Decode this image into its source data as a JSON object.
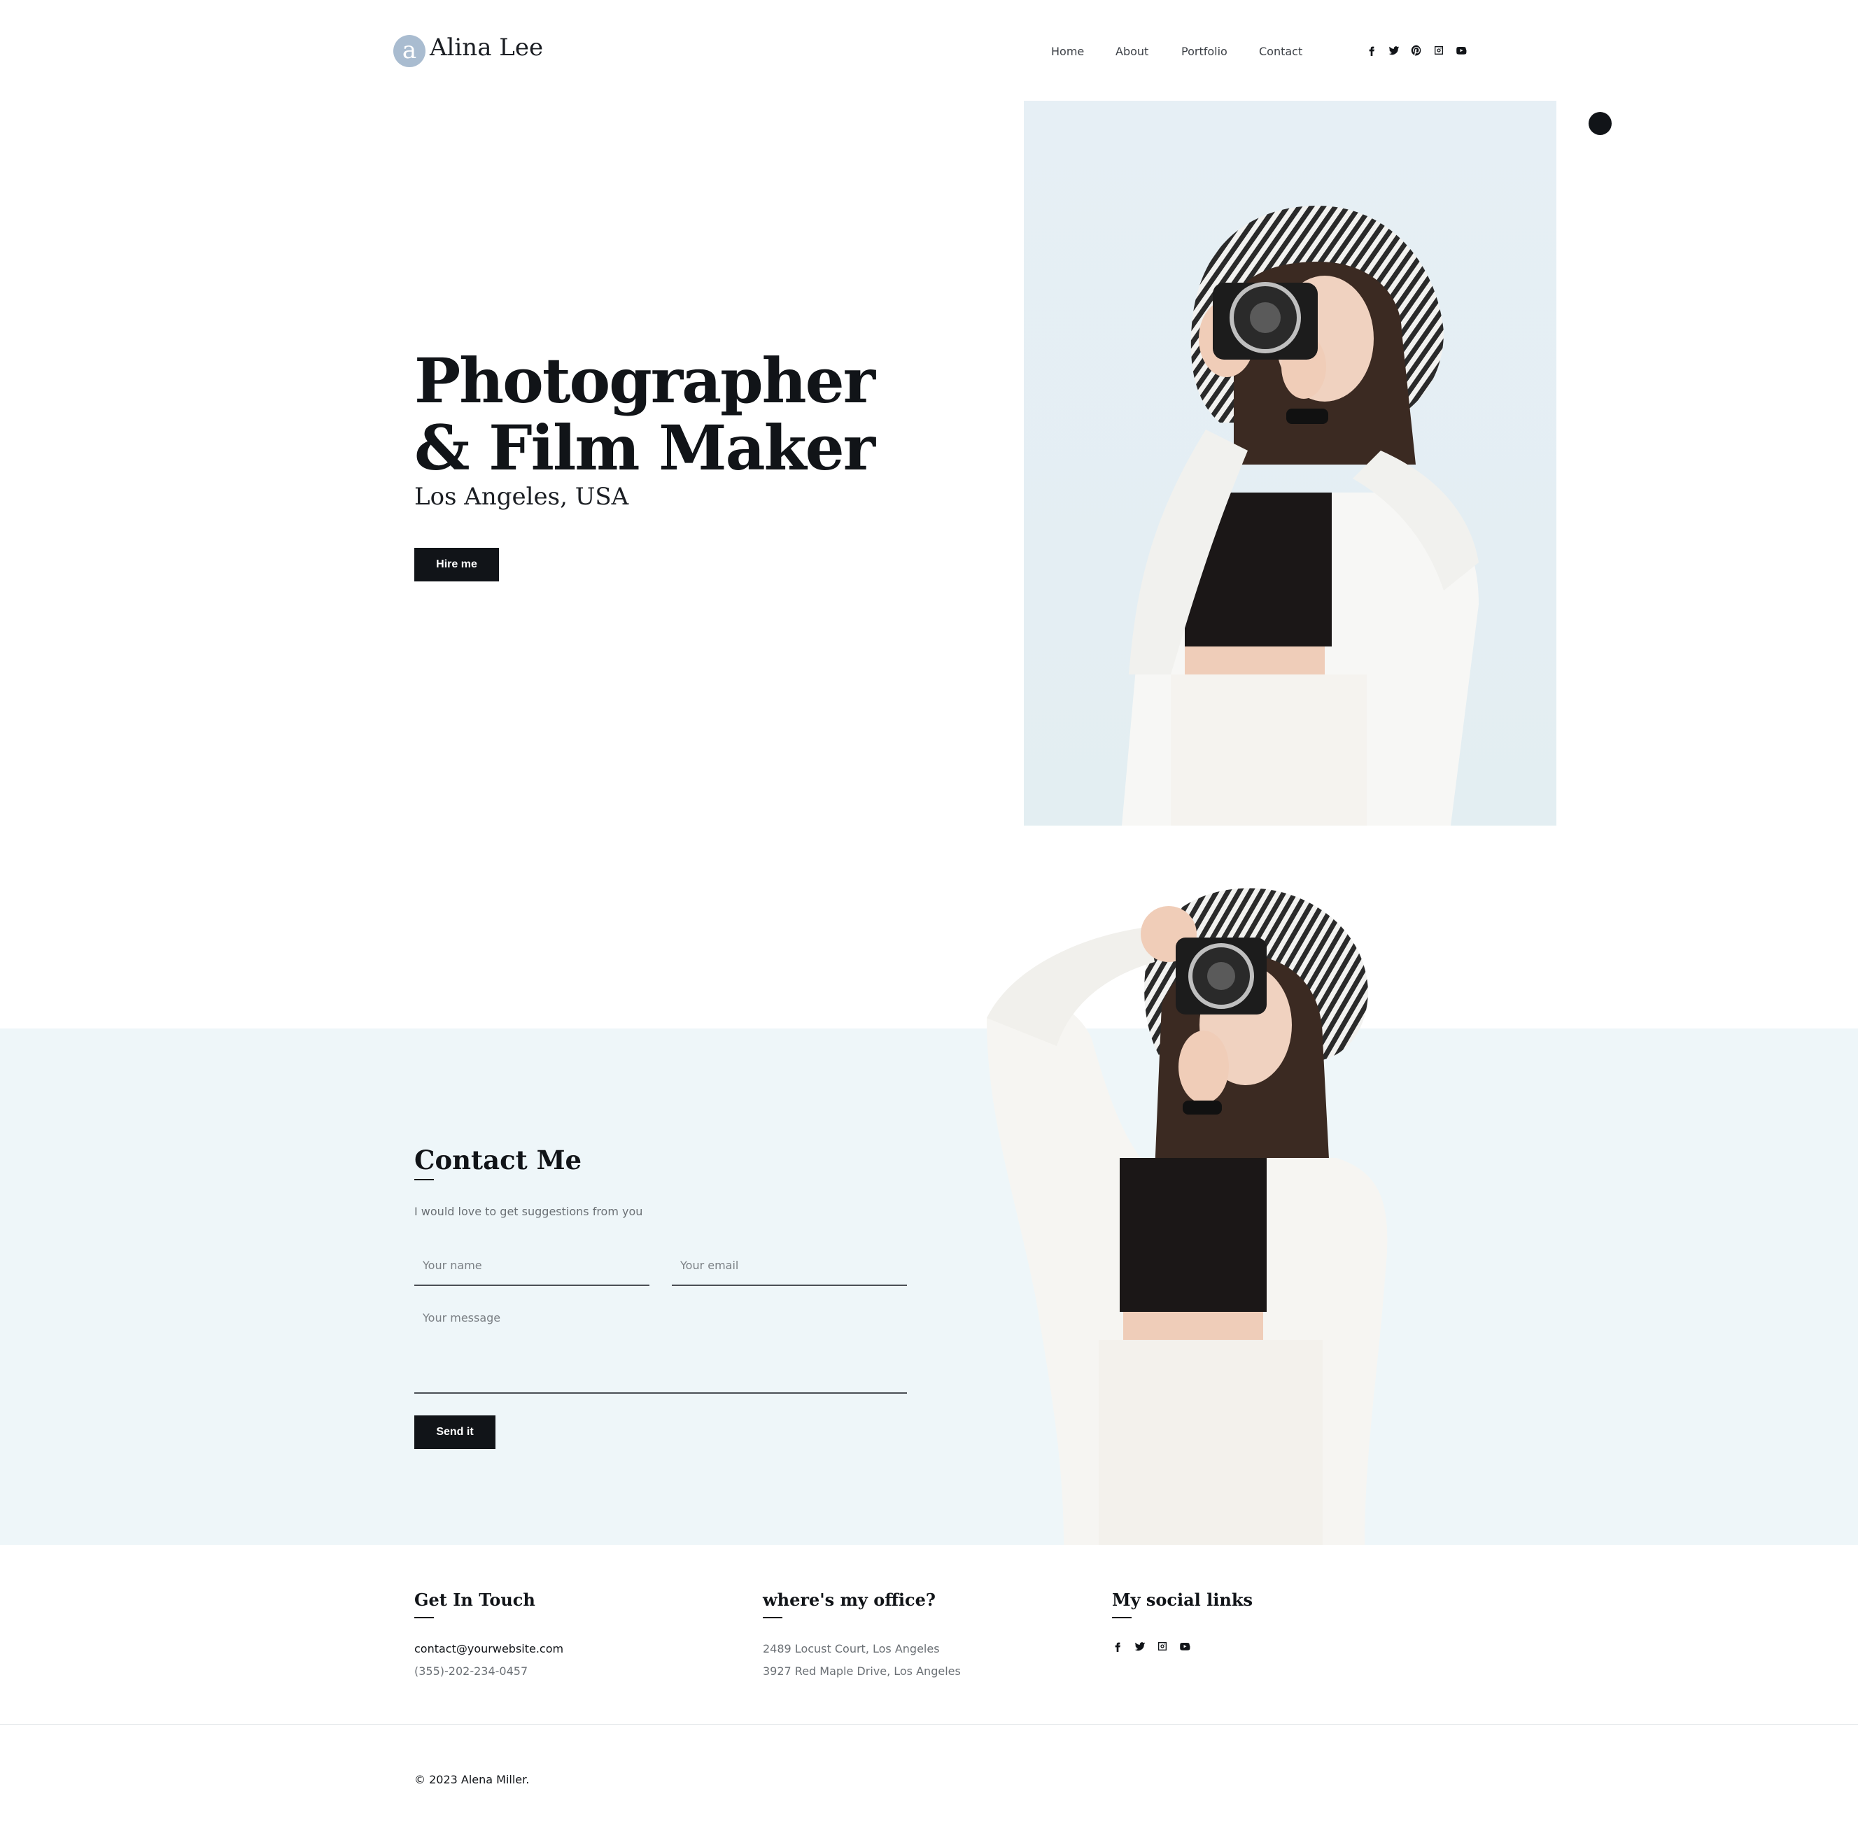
{
  "header": {
    "logo_mark": "a",
    "logo_text": "Alina Lee",
    "nav": [
      "Home",
      "About",
      "Portfolio",
      "Contact"
    ],
    "social_icons": [
      "facebook-icon",
      "twitter-icon",
      "pinterest-icon",
      "instagram-icon",
      "youtube-icon"
    ]
  },
  "hero": {
    "title_line1": "Photographer",
    "title_line2": "& Film Maker",
    "subtitle": "Los Angeles, USA",
    "cta_label": "Hire me"
  },
  "contact": {
    "title": "Contact Me",
    "description": "I would love to get suggestions from you",
    "name_placeholder": "Your name",
    "email_placeholder": "Your email",
    "message_placeholder": "Your message",
    "send_label": "Send it"
  },
  "footer": {
    "touch_title": "Get In Touch",
    "email": "contact@yourwebsite.com",
    "phone": "(355)-202-234-0457",
    "office_title": "where's my office?",
    "address1": "2489 Locust Court, Los Angeles",
    "address2": "3927 Red Maple Drive, Los Angeles",
    "social_title": "My social links",
    "social_icons": [
      "facebook-icon",
      "twitter-icon",
      "instagram-icon",
      "youtube-icon"
    ],
    "copyright": "© 2023 Alena Miller."
  },
  "colors": {
    "primary": "#111418",
    "band_background": "#eef6f9",
    "logo_mark": "#a9bcd0",
    "photo_background": "#e6eff5"
  }
}
